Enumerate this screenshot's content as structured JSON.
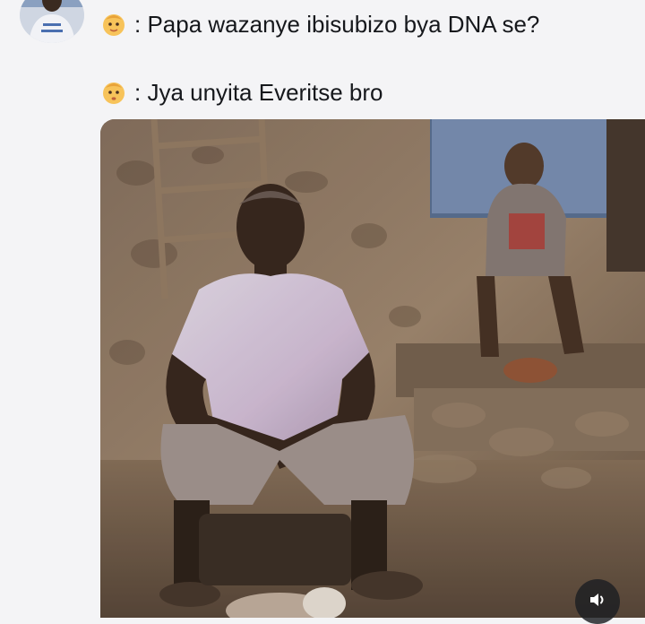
{
  "post": {
    "line1": {
      "emoji": "baby-face-emoji",
      "text": ": Papa wazanye ibisubizo bya DNA se?"
    },
    "line2": {
      "emoji": "baby-face-emoji",
      "text": ": Jya unyita Everitse bro"
    }
  },
  "media": {
    "icons": {
      "avatar": "profile-avatar",
      "sound": "speaker-icon"
    }
  },
  "colors": {
    "background": "#f4f4f6",
    "text": "#16181c",
    "sound_button_bg": "#1c1e22"
  }
}
